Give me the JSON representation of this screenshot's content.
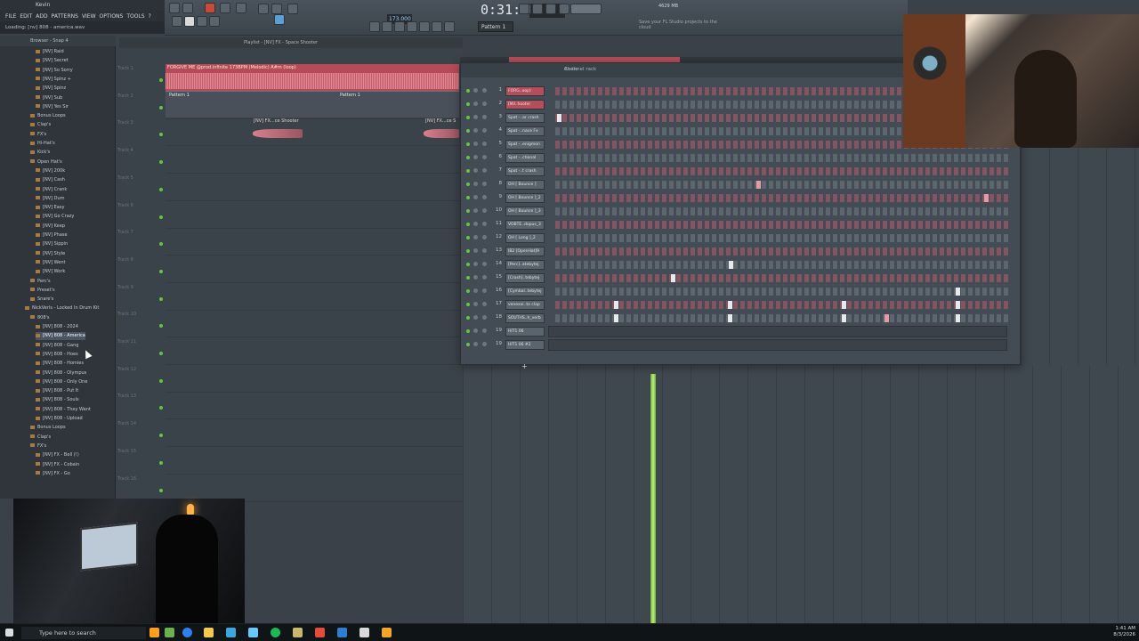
{
  "window": {
    "title": "Kevin",
    "loading_hint": "Loading: [nv] 808 - america.wav"
  },
  "menu": [
    "FILE",
    "EDIT",
    "ADD",
    "PATTERNS",
    "VIEW",
    "OPTIONS",
    "TOOLS",
    "?"
  ],
  "toolbar": {
    "time": "0:31:73",
    "tempo": "173.000",
    "pattern": "Pattern 1",
    "cpu": "4629 MB",
    "cloud_tip": "Save your FL Studio projects to the cloud"
  },
  "browser": {
    "header": "Browser - Snap 4",
    "items": [
      {
        "label": "[NV] Raid",
        "indent": 1
      },
      {
        "label": "[NV] Secret",
        "indent": 1
      },
      {
        "label": "[NV] So Sorry",
        "indent": 1
      },
      {
        "label": "[NV] Spinz +",
        "indent": 1
      },
      {
        "label": "[NV] Spinz",
        "indent": 1
      },
      {
        "label": "[NV] Sub",
        "indent": 1
      },
      {
        "label": "[NV] Yes Sir",
        "indent": 1
      },
      {
        "label": "Bonus Loops",
        "indent": 0
      },
      {
        "label": "Clap's",
        "indent": 0
      },
      {
        "label": "FX's",
        "indent": 0
      },
      {
        "label": "Hi-Hat's",
        "indent": 0
      },
      {
        "label": "Kick's",
        "indent": 0
      },
      {
        "label": "Open Hat's",
        "indent": 0
      },
      {
        "label": "[NV] 200k",
        "indent": 1
      },
      {
        "label": "[NV] Cash",
        "indent": 1
      },
      {
        "label": "[NV] Crank",
        "indent": 1
      },
      {
        "label": "[NV] Dum",
        "indent": 1
      },
      {
        "label": "[NV] Easy",
        "indent": 1
      },
      {
        "label": "[NV] Go Crazy",
        "indent": 1
      },
      {
        "label": "[NV] Keep",
        "indent": 1
      },
      {
        "label": "[NV] Phase",
        "indent": 1
      },
      {
        "label": "[NV] Sippin",
        "indent": 1
      },
      {
        "label": "[NV] Style",
        "indent": 1
      },
      {
        "label": "[NV] Went",
        "indent": 1
      },
      {
        "label": "[NV] Work",
        "indent": 1
      },
      {
        "label": "Perc's",
        "indent": 0
      },
      {
        "label": "Preset's",
        "indent": 0
      },
      {
        "label": "Snare's",
        "indent": 0
      },
      {
        "label": "NickVerls - Locked In Drum Kit",
        "indent": -1
      },
      {
        "label": "808's",
        "indent": 0
      },
      {
        "label": "[NV] 808 - 2024",
        "indent": 1
      },
      {
        "label": "[NV] 808 - America",
        "indent": 1,
        "selected": true
      },
      {
        "label": "[NV] 808 - Gang",
        "indent": 1
      },
      {
        "label": "[NV] 808 - Hoes",
        "indent": 1
      },
      {
        "label": "[NV] 808 - Homies",
        "indent": 1
      },
      {
        "label": "[NV] 808 - Olympus",
        "indent": 1
      },
      {
        "label": "[NV] 808 - Only One",
        "indent": 1
      },
      {
        "label": "[NV] 808 - Put It",
        "indent": 1
      },
      {
        "label": "[NV] 808 - Souls",
        "indent": 1
      },
      {
        "label": "[NV] 808 - They Want",
        "indent": 1
      },
      {
        "label": "[NV] 808 - Upload",
        "indent": 1
      },
      {
        "label": "Bonus Loops",
        "indent": 0
      },
      {
        "label": "Clap's",
        "indent": 0
      },
      {
        "label": "FX's",
        "indent": 0
      },
      {
        "label": "[NV] FX - Bell (!)",
        "indent": 1
      },
      {
        "label": "[NV] FX - Cobain",
        "indent": 1
      },
      {
        "label": "[NV] FX - Go",
        "indent": 1
      }
    ]
  },
  "playlist": {
    "title": "Playlist - [NV] FX - Space Shooter",
    "tracks": [
      "Track 1",
      "Track 2",
      "Track 3",
      "Track 4",
      "Track 5",
      "Track 6",
      "Track 7",
      "Track 8",
      "Track 9",
      "Track 10",
      "Track 11",
      "Track 12",
      "Track 13",
      "Track 14",
      "Track 15",
      "Track 16"
    ],
    "audio_clip": "FORGIVE ME @prod.infinite 173BPM (Melodic) A#m (loop)",
    "pattern_clip_1": "Pattern 1",
    "pattern_clip_2": "Pattern 1",
    "fx_clip_1": "[NV] FX...ce Shooter",
    "fx_clip_2": "[NV] FX...ce S"
  },
  "rack": {
    "title": "Channel rack",
    "audio_label": "Audio",
    "channels": [
      {
        "n": "1",
        "name": "FORG..oop)",
        "hl": true
      },
      {
        "n": "2",
        "name": "[NV..hooter",
        "hl": true
      },
      {
        "n": "3",
        "name": "Spat -..ar crash"
      },
      {
        "n": "4",
        "name": "Spat -..nace Fx"
      },
      {
        "n": "5",
        "name": "Spat -..enigmon"
      },
      {
        "n": "6",
        "name": "Spat -..ctional"
      },
      {
        "n": "7",
        "name": "Spat -..t crash"
      },
      {
        "n": "8",
        "name": "OH [ Bounce ]"
      },
      {
        "n": "9",
        "name": "OH [ Bounce ]_2"
      },
      {
        "n": "10",
        "name": "OH [ Bounce ]_3"
      },
      {
        "n": "11",
        "name": "VOBTE..dopus_3"
      },
      {
        "n": "12",
        "name": "OH [ Long ]_2"
      },
      {
        "n": "13",
        "name": "IB2 [OpenHat]9"
      },
      {
        "n": "14",
        "name": "[Perc]..atebytej"
      },
      {
        "n": "15",
        "name": "[Crash]..tebytej"
      },
      {
        "n": "16",
        "name": "[Cymbal..tebytej"
      },
      {
        "n": "17",
        "name": "venexxi..to clap"
      },
      {
        "n": "18",
        "name": "SOUTHS..h_verb"
      },
      {
        "n": "19",
        "name": "HIT1 06"
      },
      {
        "n": "19",
        "name": "HIT1 06 #2"
      }
    ]
  },
  "taskbar": {
    "search_placeholder": "Type here to search",
    "time": "1:41 AM",
    "date": "8/3/2026"
  }
}
